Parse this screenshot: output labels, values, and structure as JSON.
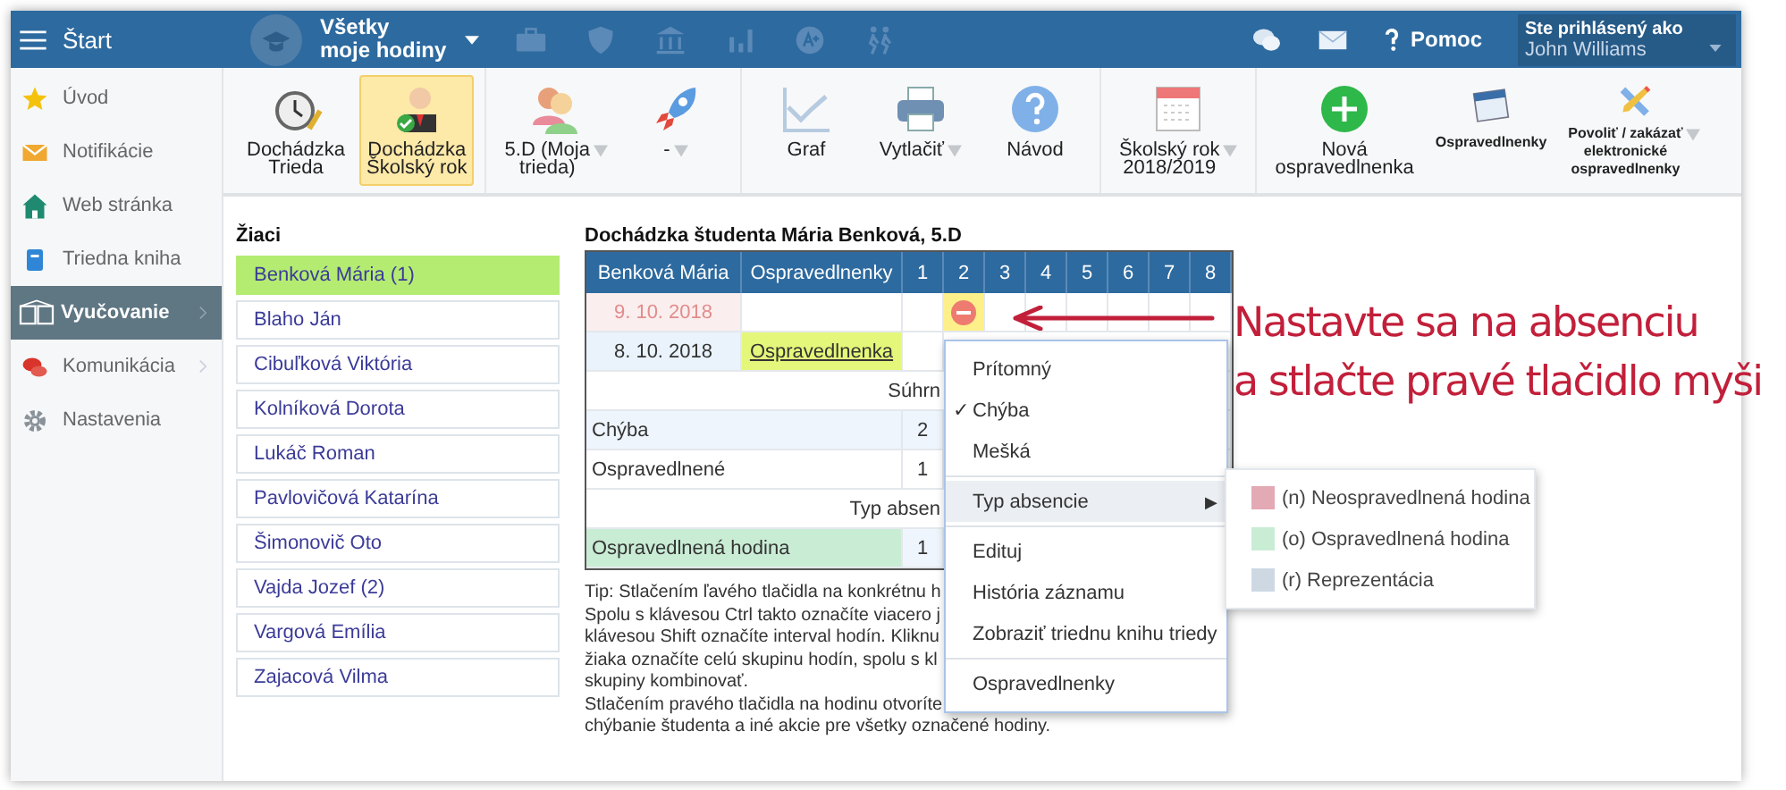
{
  "topbar": {
    "start": "Štart",
    "lessons_selector": "Všetky\nmoje hodiny",
    "help": "Pomoc",
    "user_caption": "Ste prihlásený ako",
    "user_name": "John Williams"
  },
  "sidebar": {
    "items": [
      {
        "label": "Úvod",
        "selected": false,
        "submenu": false
      },
      {
        "label": "Notifikácie",
        "selected": false,
        "submenu": false
      },
      {
        "label": "Web stránka",
        "selected": false,
        "submenu": false
      },
      {
        "label": "Triedna kniha",
        "selected": false,
        "submenu": false
      },
      {
        "label": "Vyučovanie",
        "selected": true,
        "submenu": true
      },
      {
        "label": "Komunikácia",
        "selected": false,
        "submenu": true
      },
      {
        "label": "Nastavenia",
        "selected": false,
        "submenu": false
      }
    ]
  },
  "toolbar": {
    "groups": [
      [
        {
          "label": "Dochádzka\nTrieda",
          "selected": false,
          "dropdown": false,
          "kind": "large"
        },
        {
          "label": "Dochádzka\nŠkolský rok",
          "selected": true,
          "dropdown": false,
          "kind": "large"
        }
      ],
      [
        {
          "label": "5.D (Moja\ntrieda)",
          "selected": false,
          "dropdown": true,
          "kind": "large"
        },
        {
          "label": "-",
          "selected": false,
          "dropdown": true,
          "kind": "large"
        }
      ],
      [
        {
          "label": "Graf",
          "selected": false,
          "dropdown": false,
          "kind": "large"
        },
        {
          "label": "Vytlačiť",
          "selected": false,
          "dropdown": true,
          "kind": "large"
        },
        {
          "label": "Návod",
          "selected": false,
          "dropdown": false,
          "kind": "large"
        }
      ],
      [
        {
          "label": "Školský rok\n2018/2019",
          "selected": false,
          "dropdown": true,
          "kind": "large"
        }
      ],
      [
        {
          "label": "Nová\nospravedlnenka",
          "selected": false,
          "dropdown": false,
          "kind": "large"
        },
        {
          "label": "Ospravedlnenky",
          "selected": false,
          "dropdown": false,
          "kind": "small"
        },
        {
          "label": "Povoliť / zakázať\nelektronické\nospravedlnenky",
          "selected": false,
          "dropdown": true,
          "kind": "small"
        }
      ]
    ]
  },
  "students": {
    "title": "Žiaci",
    "items": [
      {
        "name": "Benková Mária (1)",
        "selected": true
      },
      {
        "name": "Blaho Ján",
        "selected": false
      },
      {
        "name": "Cibuľková Viktória",
        "selected": false
      },
      {
        "name": "Kolníková Dorota",
        "selected": false
      },
      {
        "name": "Lukáč Roman",
        "selected": false
      },
      {
        "name": "Pavlovičová Katarína",
        "selected": false
      },
      {
        "name": "Šimonovič Oto",
        "selected": false
      },
      {
        "name": "Vajda Jozef (2)",
        "selected": false
      },
      {
        "name": "Vargová Emília",
        "selected": false
      },
      {
        "name": "Zajacová Vilma",
        "selected": false
      }
    ]
  },
  "attendance": {
    "title": "Dochádzka študenta Mária Benková, 5.D",
    "columns": [
      "Benková Mária",
      "Ospravedlnenky",
      "1",
      "2",
      "3",
      "4",
      "5",
      "6",
      "7",
      "8"
    ],
    "rows": [
      {
        "date": "9. 10. 2018",
        "kind": "current",
        "excuse": "",
        "lessons": [
          {
            "absent": false
          },
          {
            "absent": true
          },
          {
            "absent": false
          },
          {
            "absent": false
          },
          {
            "absent": false
          },
          {
            "absent": false
          },
          {
            "absent": false
          },
          {
            "absent": false
          }
        ]
      },
      {
        "date": "8. 10. 2018",
        "kind": "past",
        "excuse": "Ospravedlnenka",
        "lessons": [
          {
            "absent": false
          }
        ]
      }
    ],
    "summary": [
      {
        "title": "Súhrn",
        "rows": [
          {
            "label": "Chýba",
            "value": "2"
          },
          {
            "label": "Ospravedlnené",
            "value": "1"
          }
        ]
      },
      {
        "title": "Typ absen",
        "rows": [
          {
            "label": "Ospravedlnená hodina",
            "value": "1",
            "color": "#c9ecd5"
          }
        ]
      }
    ],
    "tip": [
      "Tip: Stlačením ľavého tlačidla na konkrétnu h",
      "Spolu s klávesou Ctrl takto označíte viacero j",
      "klávesou Shift označíte interval hodín. Kliknu",
      "žiaka označíte celú skupinu hodín, spolu s kl",
      "skupiny kombinovať.",
      "Stlačením pravého tlačidla na hodinu otvoríte",
      "chýbanie študenta a iné akcie pre všetky označené hodiny."
    ]
  },
  "context_menu": {
    "groups": [
      [
        {
          "label": "Prítomný",
          "checked": false,
          "highlighted": false,
          "submenu": false
        },
        {
          "label": "Chýba",
          "checked": true,
          "highlighted": false,
          "submenu": false
        },
        {
          "label": "Mešká",
          "checked": false,
          "highlighted": false,
          "submenu": false
        }
      ],
      [
        {
          "label": "Typ absencie",
          "checked": false,
          "highlighted": true,
          "submenu": true,
          "arrow": "▶"
        }
      ],
      [
        {
          "label": "Edituj",
          "checked": false,
          "highlighted": false,
          "submenu": false
        },
        {
          "label": "História záznamu",
          "checked": false,
          "highlighted": false,
          "submenu": false
        },
        {
          "label": "Zobraziť triednu knihu triedy",
          "checked": false,
          "highlighted": false,
          "submenu": false
        }
      ],
      [
        {
          "label": "Ospravedlnenky",
          "checked": false,
          "highlighted": false,
          "submenu": false
        }
      ]
    ],
    "check_mark": "✓",
    "submenu": [
      {
        "label": "(n) Neospravedlnená hodina",
        "color": "#e3a9b4"
      },
      {
        "label": "(o) Ospravedlnená hodina",
        "color": "#c9ecd5"
      },
      {
        "label": "(r) Reprezentácia",
        "color": "#cdd8e3"
      }
    ]
  },
  "annotation": {
    "lines": [
      "Nastavte sa na absenciu",
      "a stlačte pravé tlačidlo myši"
    ]
  }
}
